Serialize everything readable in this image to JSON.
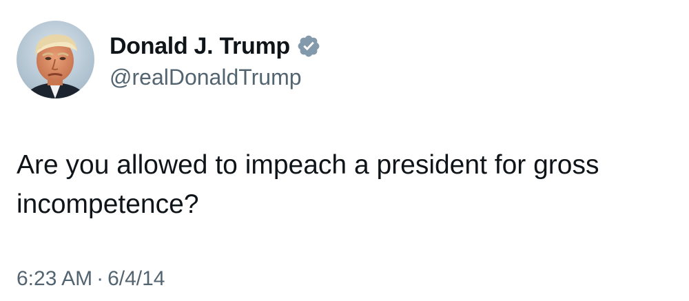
{
  "author": {
    "display_name": "Donald J. Trump",
    "handle": "@realDonaldTrump",
    "verified": true,
    "verified_icon": "verified-badge-icon",
    "avatar_icon": "profile-photo"
  },
  "tweet": {
    "text": "Are you allowed to impeach a president for gross incompetence?",
    "time": "6:23 AM",
    "separator": "·",
    "date": "6/4/14"
  },
  "colors": {
    "primary_text": "#0f1419",
    "secondary_text": "#536471",
    "verified_badge": "#829aab",
    "background": "#ffffff"
  }
}
